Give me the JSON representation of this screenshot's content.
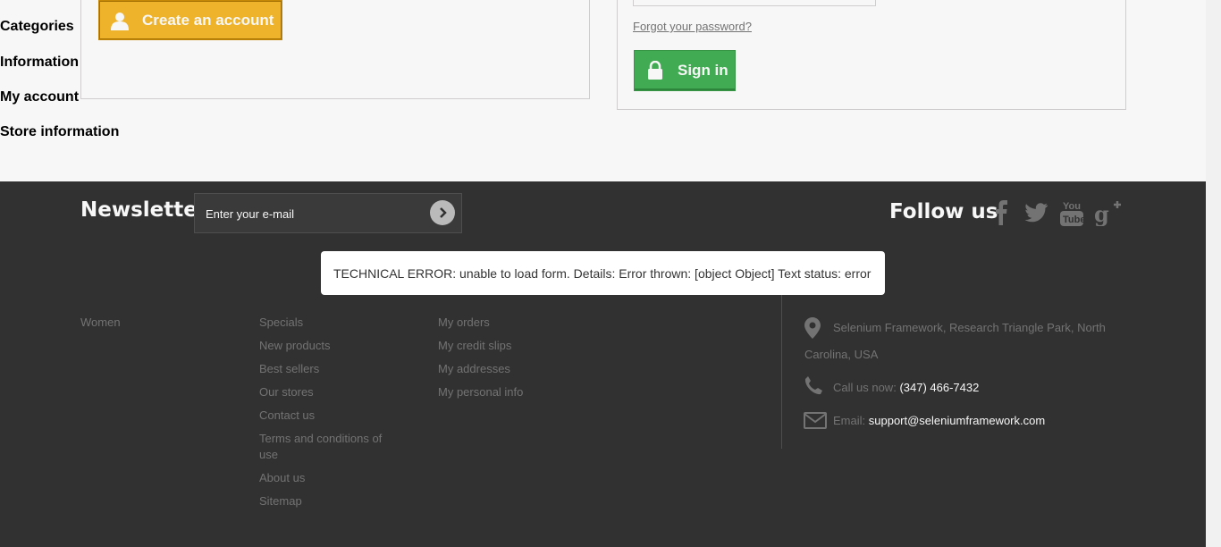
{
  "login": {
    "create_account_label": "Create an account",
    "forgot_password_label": "Forgot your password?",
    "sign_in_label": "Sign in"
  },
  "newsletter": {
    "title": "Newsletter",
    "placeholder": "Enter your e-mail"
  },
  "social": {
    "title": "Follow us",
    "icons": [
      "facebook-icon",
      "twitter-icon",
      "youtube-icon",
      "google-plus-icon"
    ]
  },
  "footer": {
    "categories": {
      "title": "Categories",
      "items": [
        "Women"
      ]
    },
    "information": {
      "title": "Information",
      "items": [
        "Specials",
        "New products",
        "Best sellers",
        "Our stores",
        "Contact us",
        "Terms and conditions of use",
        "About us",
        "Sitemap"
      ]
    },
    "my_account": {
      "title": "My account",
      "items": [
        "My orders",
        "My credit slips",
        "My addresses",
        "My personal info"
      ]
    },
    "store": {
      "title": "Store information",
      "address": "Selenium Framework, Research Triangle Park, North Carolina, USA",
      "call_label": "Call us now:",
      "phone": "(347) 466-7432",
      "email_label": "Email:",
      "email": "support@seleniumframework.com"
    }
  },
  "modal": {
    "message": "TECHNICAL ERROR: unable to load form. Details: Error thrown: [object Object] Text status: error"
  },
  "colors": {
    "create_button": "#f6b92d",
    "sign_in_button": "#43b155",
    "footer_bg": "#333333"
  }
}
